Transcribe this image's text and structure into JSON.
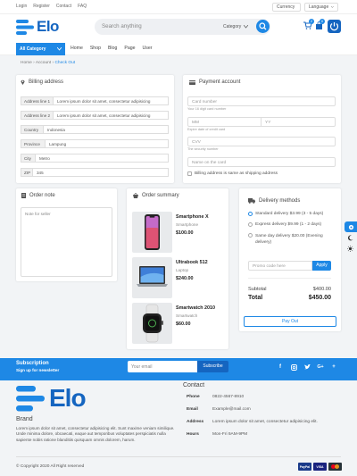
{
  "top_links": [
    "Login",
    "Register",
    "Contact",
    "FAQ"
  ],
  "currency": "Currency",
  "language": "Language",
  "brand": {
    "name": "Elo",
    "color": "#1e88e5"
  },
  "search": {
    "placeholder": "Search anything",
    "category": "Category"
  },
  "cart": {
    "badge1": "2",
    "badge2": "0"
  },
  "nav": {
    "all_category": "All Category",
    "links": [
      "Home",
      "Shop",
      "Blog",
      "Page",
      "User"
    ]
  },
  "breadcrumb": {
    "home": "Home",
    "account": "Account",
    "current": "Check Out"
  },
  "billing": {
    "title": "Billing address",
    "rows": [
      {
        "label": "Address line 1",
        "value": "Lorem ipsum dolor sit amet, consectetur adipisicing"
      },
      {
        "label": "Address line 2",
        "value": "Lorem ipsum dolor sit amet, consectetur adipisicing"
      },
      {
        "label": "Country",
        "value": "Indonesia"
      },
      {
        "label": "Province",
        "value": "Lampung"
      },
      {
        "label": "City",
        "value": "Metro"
      },
      {
        "label": "ZIP",
        "value": "345"
      }
    ]
  },
  "payment": {
    "title": "Payment account",
    "card_number": "Card number",
    "card_hint": "Your 16 digit card number",
    "mm": "MM",
    "yy": "YY",
    "expiry_hint": "Expire date of credit card",
    "cvv": "CVV",
    "cvv_hint": "The security number",
    "name": "Name on the card",
    "same_billing": "Billing address is same as shipping address"
  },
  "order_note": {
    "title": "Order note",
    "placeholder": "Note for seller"
  },
  "order_summary": {
    "title": "Order summary",
    "products": [
      {
        "name": "Smartphone X",
        "category": "Smartphone",
        "price": "$100.00"
      },
      {
        "name": "Ultrabook 512",
        "category": "Laptop",
        "price": "$240.00"
      },
      {
        "name": "Smartwatch 2010",
        "category": "Smartwatch",
        "price": "$60.00"
      }
    ]
  },
  "delivery": {
    "title": "Delivery methods",
    "options": [
      {
        "label": "Standard delivery $3.99 (3 - 5 days)",
        "selected": true
      },
      {
        "label": "Express delivery $9.99 (1 - 2 days)",
        "selected": false
      },
      {
        "label": "Same day delivery $20.00 (Evening delivery)",
        "selected": false
      }
    ],
    "promo_placeholder": "Promo code here",
    "apply": "Apply",
    "subtotal_label": "Subtotal",
    "subtotal": "$400.00",
    "total_label": "Total",
    "total": "$450.00",
    "pay": "Pay Out"
  },
  "subscribe": {
    "title": "Subscription",
    "subtitle": "Sign up for newsletter",
    "placeholder": "Your email",
    "button": "Subscribe"
  },
  "footer": {
    "brand_label": "Brand",
    "about": "Lorem ipsum dolor sit amet, consectetur adipisicing elit. Sunt maxime veniam similique. Unde minima dolore, obcaecati, eaque aut temporibus voluptates perspiciatis nulla sapiente nobis ratione blanditiis quisquam omnis dolorem, harum.",
    "contact_title": "Contact",
    "contacts": [
      {
        "label": "Phone",
        "value": "0822-4567-8910"
      },
      {
        "label": "Email",
        "value": "Example@mail.com"
      },
      {
        "label": "Address",
        "value": "Lorem ipsum dolor sit amet, consectetur adipisicing elit."
      },
      {
        "label": "Hours",
        "value": "Mon-Fri 9AM-9PM"
      }
    ],
    "copyright": "© Copyright 2020 All Right reserved",
    "payments": [
      "PayPal",
      "VISA",
      "MC"
    ]
  }
}
